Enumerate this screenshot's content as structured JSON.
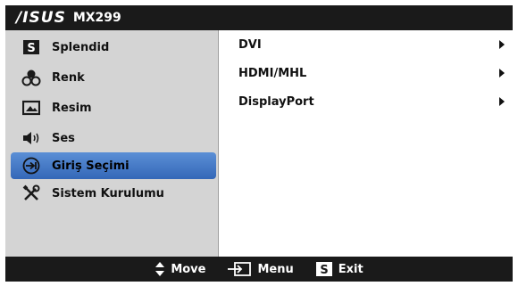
{
  "header": {
    "brand": "/ISUS",
    "model": "MX299"
  },
  "menu": {
    "items": [
      {
        "label": "Splendid",
        "icon": "splendid-s-icon",
        "selected": false
      },
      {
        "label": "Renk",
        "icon": "color-icon",
        "selected": false
      },
      {
        "label": "Resim",
        "icon": "picture-icon",
        "selected": false
      },
      {
        "label": "Ses",
        "icon": "speaker-icon",
        "selected": false
      },
      {
        "label": "Giriş Seçimi",
        "icon": "input-select-icon",
        "selected": true
      },
      {
        "label": "Sistem Kurulumu",
        "icon": "tools-icon",
        "selected": false
      }
    ]
  },
  "submenu": {
    "items": [
      {
        "label": "DVI"
      },
      {
        "label": "HDMI/MHL"
      },
      {
        "label": "DisplayPort"
      }
    ]
  },
  "footer": {
    "move_label": "Move",
    "menu_label": "Menu",
    "exit_label": "Exit"
  },
  "colors": {
    "bar": "#1a1a1a",
    "panel": "#d4d4d4",
    "highlight": "#3f74c4"
  }
}
